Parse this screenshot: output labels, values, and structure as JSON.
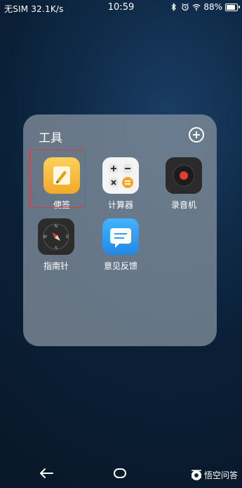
{
  "status_bar": {
    "carrier": "无SIM",
    "speed": "32.1K/s",
    "time": "10:59",
    "battery_percent": "88%",
    "battery_level": 0.88,
    "icons": [
      "bluetooth-icon",
      "alarm-icon",
      "wifi-icon",
      "battery-icon"
    ]
  },
  "folder": {
    "title": "工具",
    "apps": [
      {
        "label": "便签",
        "icon": "notes-icon",
        "color": "#f6b72d"
      },
      {
        "label": "计算器",
        "icon": "calculator-icon",
        "color": "#f2f2f2"
      },
      {
        "label": "录音机",
        "icon": "recorder-icon",
        "color": "#2a2a2a"
      },
      {
        "label": "指南针",
        "icon": "compass-icon",
        "color": "#2c2c2c"
      },
      {
        "label": "意见反馈",
        "icon": "feedback-icon",
        "color": "#2f9df0"
      }
    ]
  },
  "highlight_color": "#e03a3a",
  "watermark": "悟空问答"
}
